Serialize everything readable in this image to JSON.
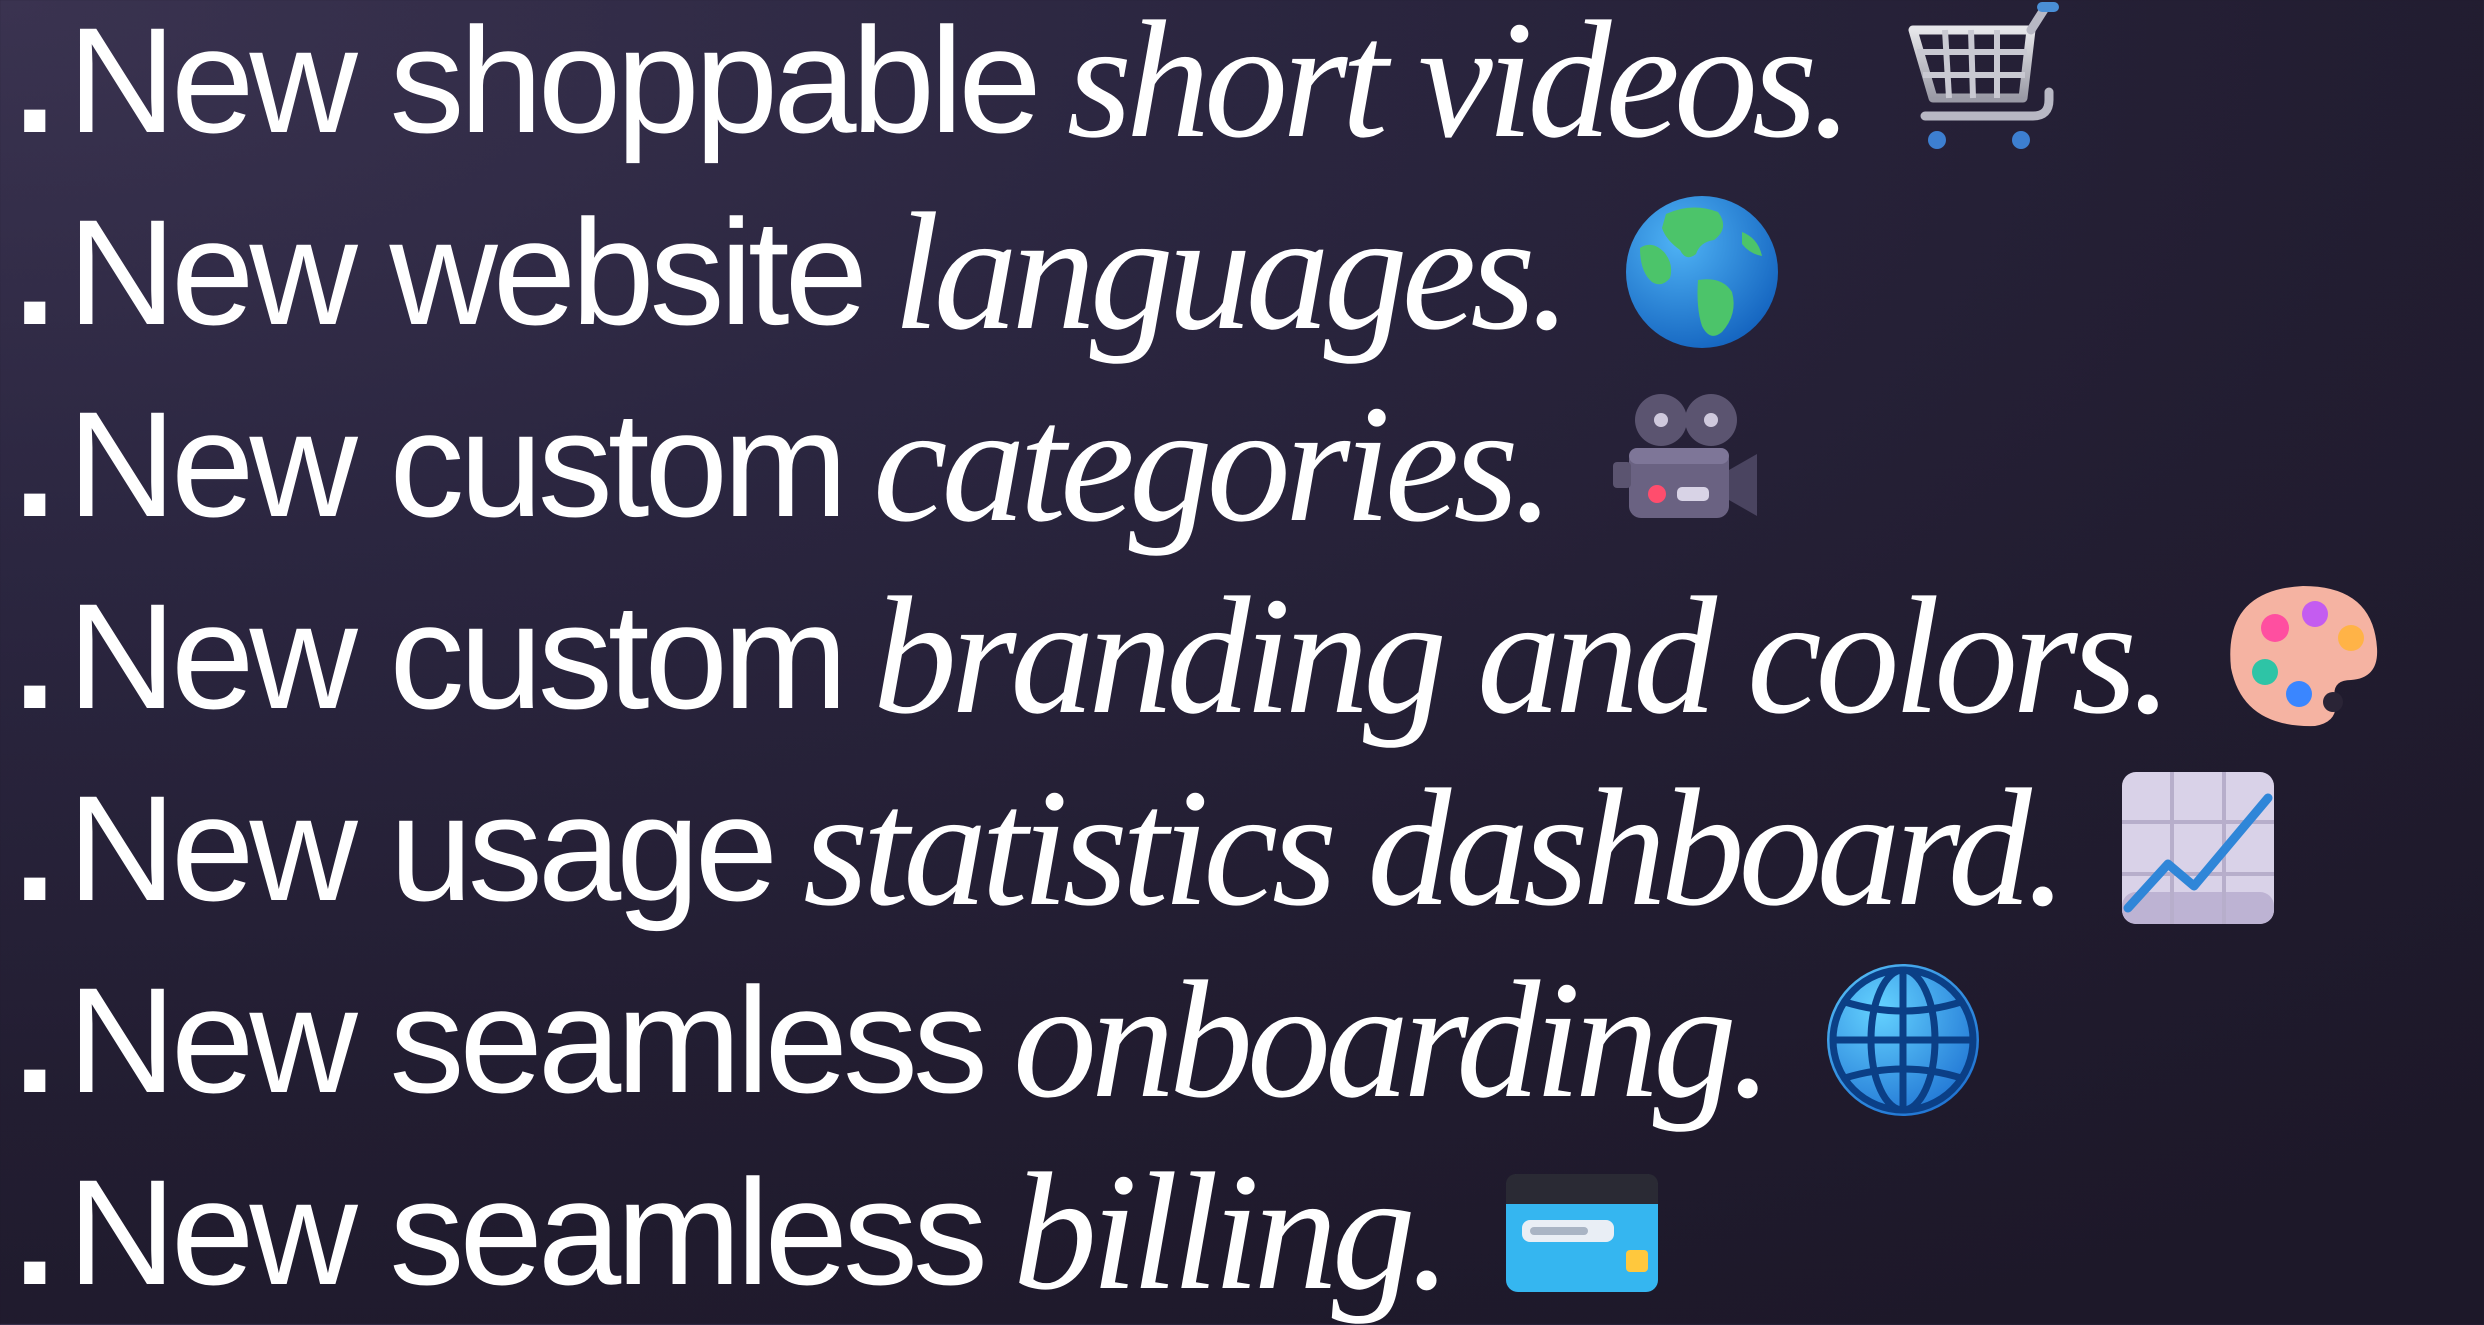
{
  "features": [
    {
      "bullet": ".",
      "lead": "New shoppable",
      "accent": "short videos.",
      "icon": "shopping-cart-icon"
    },
    {
      "bullet": ".",
      "lead": "New website",
      "accent": "languages.",
      "icon": "globe-americas-icon"
    },
    {
      "bullet": ".",
      "lead": "New custom",
      "accent": "categories.",
      "icon": "movie-camera-icon"
    },
    {
      "bullet": ".",
      "lead": "New custom",
      "accent": "branding and colors.",
      "icon": "artist-palette-icon"
    },
    {
      "bullet": ".",
      "lead": "New usage",
      "accent": "statistics dashboard.",
      "icon": "chart-increasing-icon"
    },
    {
      "bullet": ".",
      "lead": "New seamless",
      "accent": "onboarding.",
      "icon": "globe-meridians-icon"
    },
    {
      "bullet": ".",
      "lead": "New seamless",
      "accent": "billing.",
      "icon": "credit-card-icon"
    }
  ],
  "colors": {
    "text": "#ffffff",
    "background_start": "#3a3350",
    "background_end": "#1d1829"
  }
}
